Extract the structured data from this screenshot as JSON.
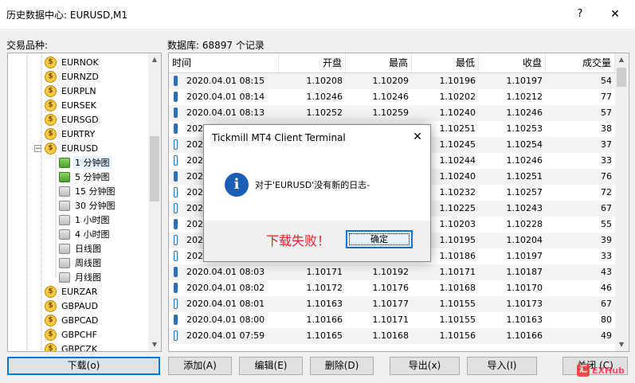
{
  "window": {
    "title": "历史数据中心: EURUSD,M1",
    "help": "?",
    "close": "✕"
  },
  "labels": {
    "symbols": "交易品种:",
    "database": "数据库: 68897 个记录"
  },
  "tree": {
    "items": [
      {
        "label": "EURNOK",
        "icon": "coin-icon"
      },
      {
        "label": "EURNZD",
        "icon": "coin-icon"
      },
      {
        "label": "EURPLN",
        "icon": "coin-icon"
      },
      {
        "label": "EURSEK",
        "icon": "coin-icon"
      },
      {
        "label": "EURSGD",
        "icon": "coin-icon"
      },
      {
        "label": "EURTRY",
        "icon": "coin-icon"
      },
      {
        "label": "EURUSD",
        "icon": "coin-icon",
        "expander": "−"
      },
      {
        "label": "1 分钟图",
        "icon": "db-green-icon"
      },
      {
        "label": "5 分钟图",
        "icon": "db-green-icon"
      },
      {
        "label": "15 分钟图",
        "icon": "db-grey-icon"
      },
      {
        "label": "30 分钟图",
        "icon": "db-grey-icon"
      },
      {
        "label": "1 小时图",
        "icon": "db-grey-icon"
      },
      {
        "label": "4 小时图",
        "icon": "db-grey-icon"
      },
      {
        "label": "日线图",
        "icon": "db-grey-icon"
      },
      {
        "label": "周线图",
        "icon": "db-grey-icon"
      },
      {
        "label": "月线图",
        "icon": "db-grey-icon"
      },
      {
        "label": "EURZAR",
        "icon": "coin-icon"
      },
      {
        "label": "GBPAUD",
        "icon": "coin-icon"
      },
      {
        "label": "GBPCAD",
        "icon": "coin-icon"
      },
      {
        "label": "GBPCHF",
        "icon": "coin-icon"
      },
      {
        "label": "GBPCZK",
        "icon": "coin-icon"
      }
    ]
  },
  "table": {
    "headers": [
      "时间",
      "开盘",
      "最高",
      "最低",
      "收盘",
      "成交量"
    ],
    "rows": [
      [
        "2020.04.01 08:15",
        "1.10208",
        "1.10209",
        "1.10196",
        "1.10197",
        "54"
      ],
      [
        "2020.04.01 08:14",
        "1.10246",
        "1.10246",
        "1.10202",
        "1.10212",
        "77"
      ],
      [
        "2020.04.01 08:13",
        "1.10252",
        "1.10259",
        "1.10240",
        "1.10246",
        "57"
      ],
      [
        "2020",
        "",
        "",
        "1.10251",
        "1.10253",
        "38"
      ],
      [
        "2020",
        "",
        "",
        "1.10245",
        "1.10254",
        "37"
      ],
      [
        "2020",
        "",
        "",
        "1.10244",
        "1.10246",
        "33"
      ],
      [
        "2020",
        "",
        "",
        "1.10240",
        "1.10251",
        "76"
      ],
      [
        "2020",
        "",
        "",
        "1.10232",
        "1.10257",
        "72"
      ],
      [
        "2020",
        "",
        "",
        "1.10225",
        "1.10243",
        "67"
      ],
      [
        "2020",
        "",
        "",
        "1.10203",
        "1.10228",
        "55"
      ],
      [
        "2020",
        "",
        "",
        "1.10195",
        "1.10204",
        "39"
      ],
      [
        "2020",
        "",
        "",
        "1.10186",
        "1.10197",
        "33"
      ],
      [
        "2020.04.01 08:03",
        "1.10171",
        "1.10192",
        "1.10171",
        "1.10187",
        "43"
      ],
      [
        "2020.04.01 08:02",
        "1.10172",
        "1.10176",
        "1.10168",
        "1.10170",
        "46"
      ],
      [
        "2020.04.01 08:01",
        "1.10163",
        "1.10177",
        "1.10155",
        "1.10173",
        "67"
      ],
      [
        "2020.04.01 08:00",
        "1.10166",
        "1.10171",
        "1.10155",
        "1.10163",
        "80"
      ],
      [
        "2020.04.01 07:59",
        "1.10165",
        "1.10168",
        "1.10156",
        "1.10166",
        "49"
      ]
    ]
  },
  "buttons": {
    "download": "下载(o)",
    "add": "添加(A)",
    "edit": "编辑(E)",
    "delete": "删除(D)",
    "export": "导出(x)",
    "import": "导入(I)",
    "close": "关闭 (C)"
  },
  "dialog": {
    "title": "Tickmill MT4 Client Terminal",
    "close": "✕",
    "icon": "i",
    "message": "对于'EURUSD'没有新的日志-",
    "annotation": "下载失败！",
    "ok": "确定"
  },
  "watermark": {
    "text": "EXHub",
    "logo": "汇"
  },
  "colors": {
    "accent": "#0078d7",
    "annotation": "#e8202a",
    "candle": "#2b6fb6"
  }
}
